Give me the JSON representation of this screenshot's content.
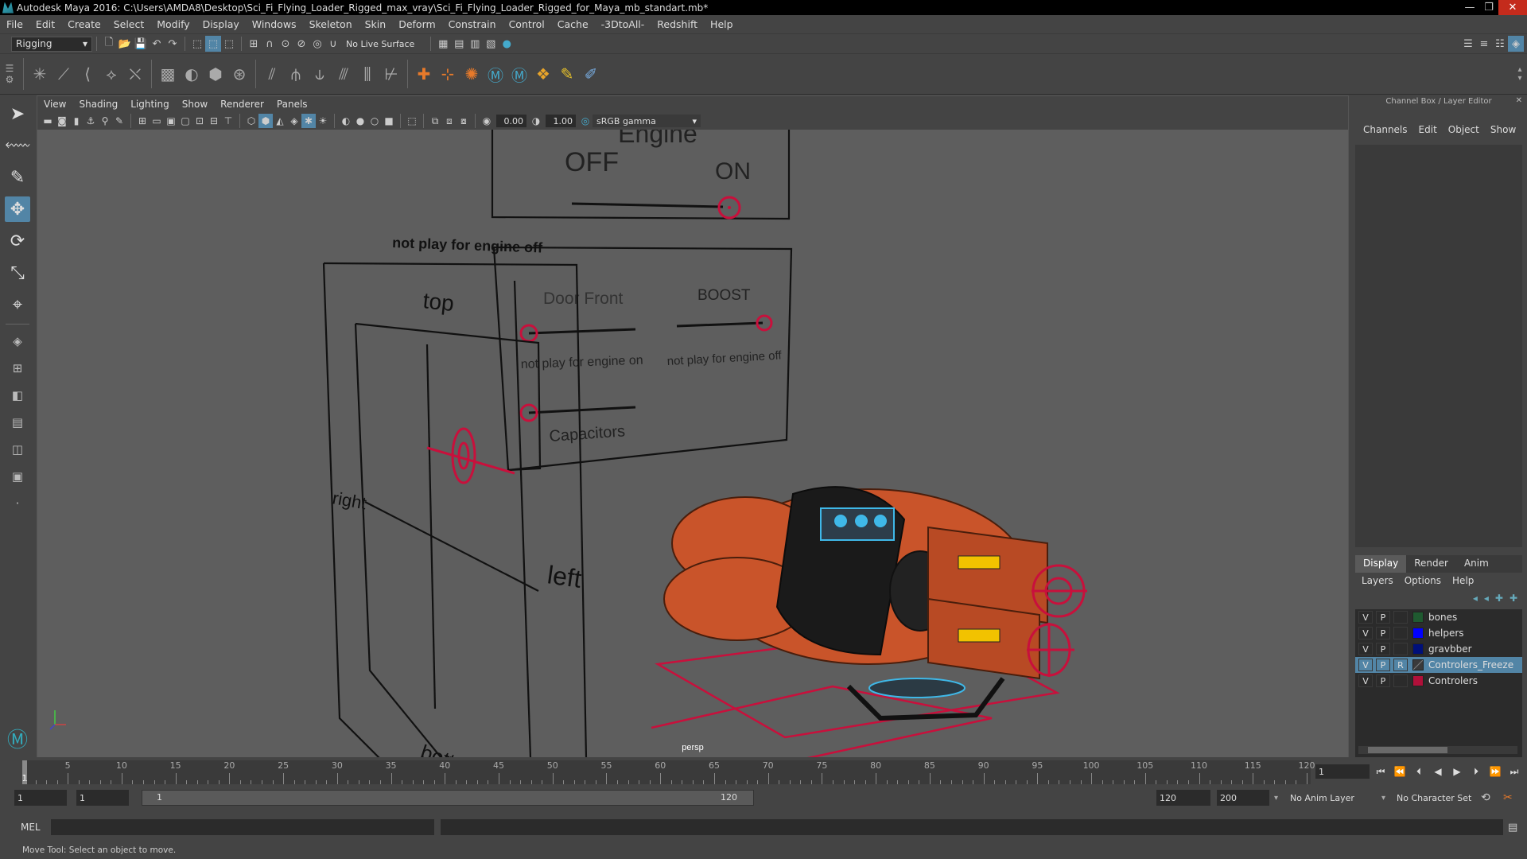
{
  "window": {
    "title": "Autodesk Maya 2016: C:\\Users\\AMDA8\\Desktop\\Sci_Fi_Flying_Loader_Rigged_max_vray\\Sci_Fi_Flying_Loader_Rigged_for_Maya_mb_standart.mb*",
    "minimize": "—",
    "maximize": "❐",
    "close": "✕"
  },
  "menu": [
    "File",
    "Edit",
    "Create",
    "Select",
    "Modify",
    "Display",
    "Windows",
    "Skeleton",
    "Skin",
    "Deform",
    "Constrain",
    "Control",
    "Cache",
    "-3DtoAll-",
    "Redshift",
    "Help"
  ],
  "status": {
    "mode": "Rigging",
    "live_surface": "No Live Surface"
  },
  "viewport": {
    "menu": [
      "View",
      "Shading",
      "Lighting",
      "Show",
      "Renderer",
      "Panels"
    ],
    "exposure": "0.00",
    "gamma": "1.00",
    "colorspace": "sRGB gamma",
    "camera": "persp",
    "overlay": {
      "engine": "Engine",
      "off": "OFF",
      "on": "ON",
      "not_play_off_small": "not play for engine off",
      "top": "top",
      "door_front": "Door Front",
      "boost": "BOOST",
      "not_play_on": "not play for engine on",
      "not_play_off": "not play for engine off",
      "capacitors": "Capacitors",
      "right": "right",
      "left": "left",
      "bottom": "bottom"
    },
    "colors": {
      "controller": "#c8103c",
      "body": "#c9542a",
      "glass": "#1a1a1a",
      "glow": "#3fb8e8",
      "stripe": "#f2c200"
    }
  },
  "channel_box": {
    "title": "Channel Box / Layer Editor",
    "tabs": [
      "Channels",
      "Edit",
      "Object",
      "Show"
    ]
  },
  "layers": {
    "tabs": [
      "Display",
      "Render",
      "Anim"
    ],
    "active_tab": "Display",
    "menu": [
      "Layers",
      "Options",
      "Help"
    ],
    "rows": [
      {
        "v": "V",
        "p": "P",
        "r": "",
        "name": "bones",
        "color": "#1f5a30",
        "selected": false
      },
      {
        "v": "V",
        "p": "P",
        "r": "",
        "name": "helpers",
        "color": "#0000ff",
        "selected": false
      },
      {
        "v": "V",
        "p": "P",
        "r": "",
        "name": "gravbber",
        "color": "#00107a",
        "selected": false
      },
      {
        "v": "V",
        "p": "P",
        "r": "R",
        "name": "Controlers_Freeze",
        "color": "#3a3a3a",
        "selected": true
      },
      {
        "v": "V",
        "p": "P",
        "r": "",
        "name": "Controlers",
        "color": "#b0103a",
        "selected": false
      }
    ]
  },
  "timeline": {
    "start": 1,
    "end": 120,
    "ticks": [
      5,
      10,
      15,
      20,
      25,
      30,
      35,
      40,
      45,
      50,
      55,
      60,
      65,
      70,
      75,
      80,
      85,
      90,
      95,
      100,
      105,
      110,
      115,
      120
    ],
    "current_frame_label": "1",
    "current_field": "1"
  },
  "range": {
    "start_field": "1",
    "anim_start_field": "1",
    "slider_start": "1",
    "slider_end": "120",
    "end_field": "120",
    "anim_end_field": "200",
    "anim_layer": "No Anim Layer",
    "character_set": "No Character Set"
  },
  "command": {
    "mel_label": "MEL"
  },
  "help_line": "Move Tool: Select an object to move."
}
